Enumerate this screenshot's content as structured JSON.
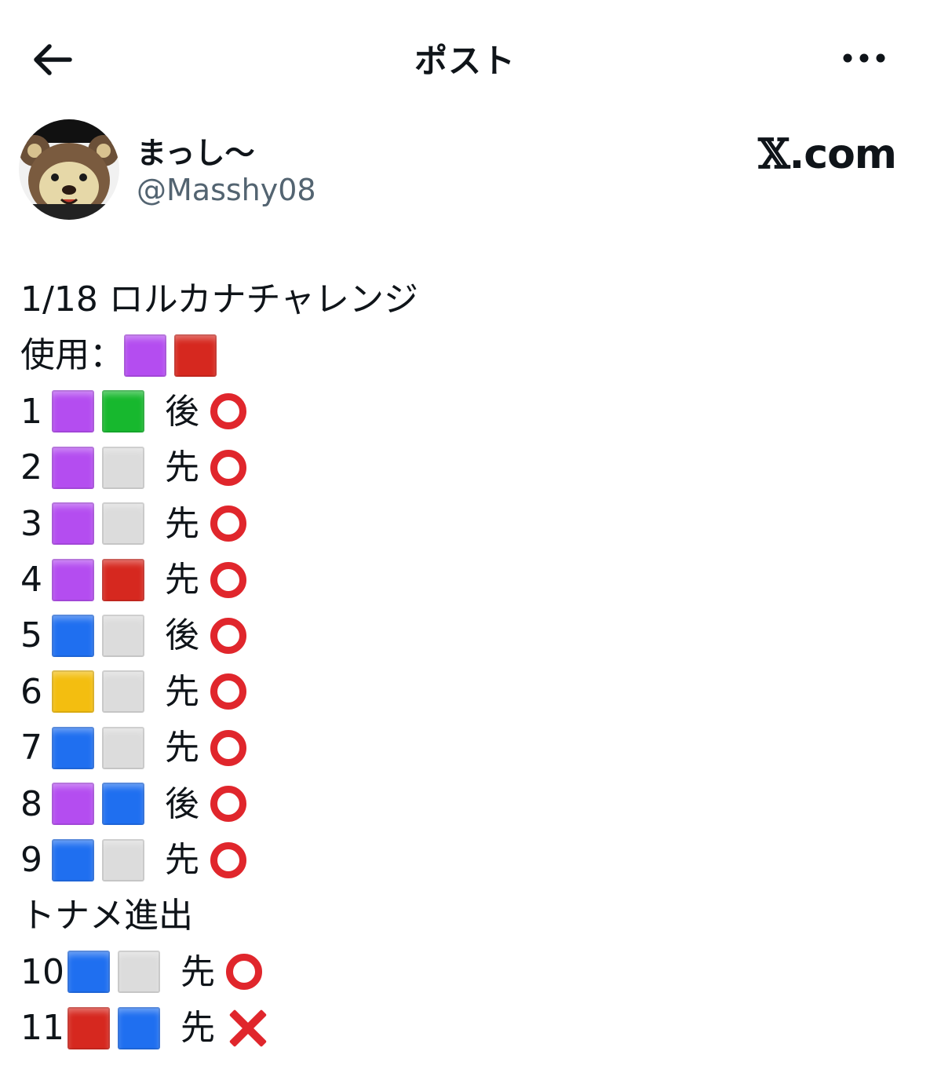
{
  "colors": {
    "purple": "#b44df0",
    "red": "#d6281f",
    "green": "#17b82e",
    "blue": "#1f6ff0",
    "yellow": "#f3be10",
    "white": "#dcdcdc",
    "result_red": "#e0262c"
  },
  "header": {
    "back_icon": "arrow-left-icon",
    "title": "ポスト",
    "more_icon": "more-horizontal-icon"
  },
  "author": {
    "display_name": "まっし〜",
    "handle": "@Masshy08",
    "avatar_icon": "bear-face-avatar",
    "brand_x": "𝕏",
    "brand_domain": ".com"
  },
  "post": {
    "heading": "1/18 ロルカナチャレンジ",
    "used_label": "使用：",
    "used_colors": [
      "purple",
      "red"
    ],
    "games": [
      {
        "num": "1",
        "deck": [
          "purple",
          "green"
        ],
        "turn": "後",
        "result": "win"
      },
      {
        "num": "2",
        "deck": [
          "purple",
          "white"
        ],
        "turn": "先",
        "result": "win"
      },
      {
        "num": "3",
        "deck": [
          "purple",
          "white"
        ],
        "turn": "先",
        "result": "win"
      },
      {
        "num": "4",
        "deck": [
          "purple",
          "red"
        ],
        "turn": "先",
        "result": "win"
      },
      {
        "num": "5",
        "deck": [
          "blue",
          "white"
        ],
        "turn": "後",
        "result": "win"
      },
      {
        "num": "6",
        "deck": [
          "yellow",
          "white"
        ],
        "turn": "先",
        "result": "win"
      },
      {
        "num": "7",
        "deck": [
          "blue",
          "white"
        ],
        "turn": "先",
        "result": "win"
      },
      {
        "num": "8",
        "deck": [
          "purple",
          "blue"
        ],
        "turn": "後",
        "result": "win"
      },
      {
        "num": "9",
        "deck": [
          "blue",
          "white"
        ],
        "turn": "先",
        "result": "win"
      }
    ],
    "advance_text": "トナメ進出",
    "tournament_games": [
      {
        "num": "10",
        "deck": [
          "blue",
          "white"
        ],
        "turn": "先",
        "result": "win"
      },
      {
        "num": "11",
        "deck": [
          "red",
          "blue"
        ],
        "turn": "先",
        "result": "loss"
      }
    ]
  }
}
